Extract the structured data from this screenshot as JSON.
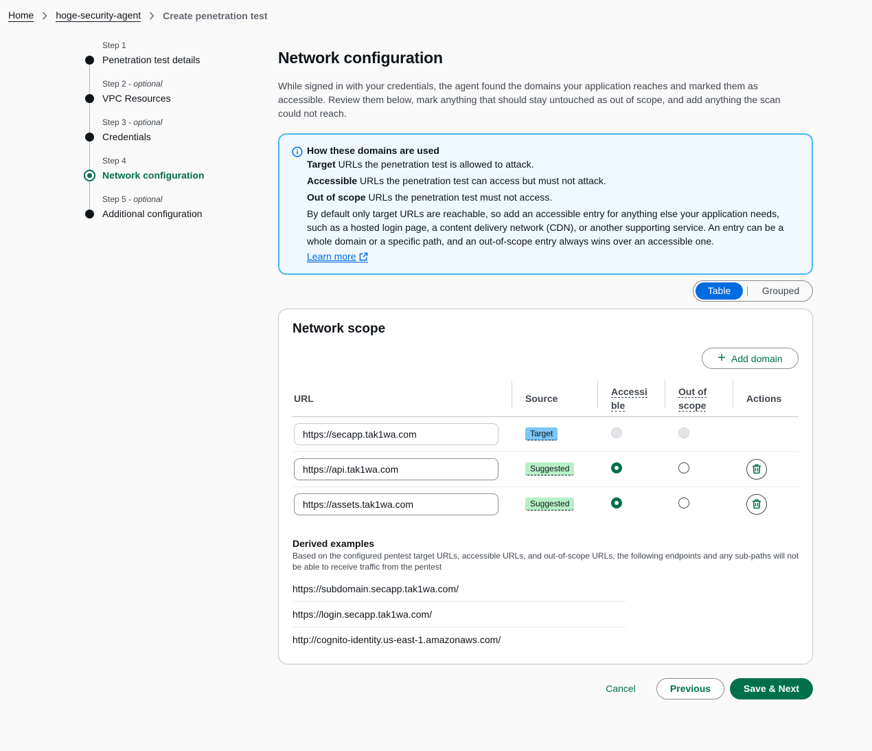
{
  "breadcrumb": {
    "home": "Home",
    "agent": "hoge-security-agent",
    "current": "Create penetration test"
  },
  "steps": [
    {
      "num": "Step 1",
      "optional": "",
      "title": "Penetration test details"
    },
    {
      "num": "Step 2 - ",
      "optional": "optional",
      "title": "VPC Resources"
    },
    {
      "num": "Step 3 - ",
      "optional": "optional",
      "title": "Credentials"
    },
    {
      "num": "Step 4",
      "optional": "",
      "title": "Network configuration"
    },
    {
      "num": "Step 5 - ",
      "optional": "optional",
      "title": "Additional configuration"
    }
  ],
  "main": {
    "title": "Network configuration",
    "description": "While signed in with your credentials, the agent found the domains your application reaches and marked them as accessible. Review them below, mark anything that should stay untouched as out of scope, and add anything the scan could not reach."
  },
  "info": {
    "heading": "How these domains are used",
    "target_term": "Target",
    "target_text": " URLs the penetration test is allowed to attack.",
    "accessible_term": "Accessible",
    "accessible_text": " URLs the penetration test can access but must not attack.",
    "oos_term": "Out of scope",
    "oos_text": " URLs the penetration test must not access.",
    "long_text": "By default only target URLs are reachable, so add an accessible entry for anything else your application needs, such as a hosted login page, a content delivery network (CDN), or another supporting service. An entry can be a whole domain or a specific path, and an out-of-scope entry always wins over an accessible one.",
    "learn_more": "Learn more"
  },
  "view_toggle": {
    "table": "Table",
    "grouped": "Grouped"
  },
  "network_scope": {
    "title": "Network scope",
    "add_domain": "Add domain",
    "columns": {
      "url": "URL",
      "source": "Source",
      "accessible_1": "Accessi",
      "accessible_2": "ble",
      "oos_1": "Out of",
      "oos_2": "scope",
      "actions": "Actions"
    },
    "rows": [
      {
        "url": "https://secapp.tak1wa.com",
        "source": "Target"
      },
      {
        "url": "https://api.tak1wa.com",
        "source": "Suggested"
      },
      {
        "url": "https://assets.tak1wa.com",
        "source": "Suggested"
      }
    ]
  },
  "derived": {
    "title": "Derived examples",
    "subtitle": "Based on the configured pentest target URLs, accessible URLs, and out-of-scope URLs, the following endpoints and any sub-paths will not be able to receive traffic from the pentest",
    "items": [
      "https://subdomain.secapp.tak1wa.com/",
      "https://login.secapp.tak1wa.com/",
      "http://cognito-identity.us-east-1.amazonaws.com/"
    ]
  },
  "footer": {
    "cancel": "Cancel",
    "previous": "Previous",
    "next": "Save & Next"
  },
  "colors": {
    "accent_green": "#00704a",
    "accent_blue": "#006ce0",
    "info_border": "#48b8f4"
  }
}
